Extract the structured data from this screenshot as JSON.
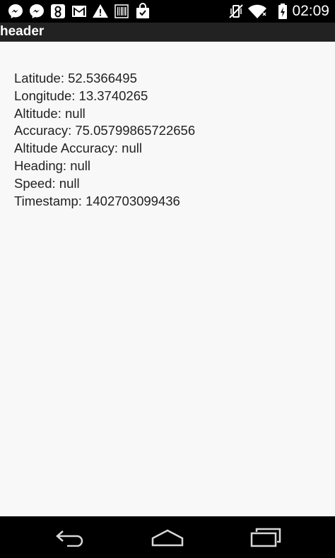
{
  "status_bar": {
    "notification_icons": [
      "messenger-icon",
      "messenger-icon",
      "shield-app-icon",
      "gmail-icon",
      "warning-icon",
      "barcode-icon",
      "shopping-bag-icon"
    ],
    "system_icons": [
      "vibrate-icon",
      "wifi-icon",
      "battery-charging-icon"
    ],
    "time": "02:09"
  },
  "action_bar": {
    "title": "header"
  },
  "location": {
    "lines": [
      "Latitude: 52.5366495",
      "Longitude: 13.3740265",
      "Altitude: null",
      "Accuracy: 75.05799865722656",
      "Altitude Accuracy: null",
      "Heading: null",
      "Speed: null",
      "Timestamp: 1402703099436"
    ]
  },
  "nav_bar": {
    "buttons": [
      "back-icon",
      "home-icon",
      "recents-icon"
    ]
  },
  "colors": {
    "status_bar_bg": "#000000",
    "action_bar_bg": "#222222",
    "content_bg": "#f8f8f8",
    "text": "#222222",
    "nav_bar_bg": "#000000"
  }
}
